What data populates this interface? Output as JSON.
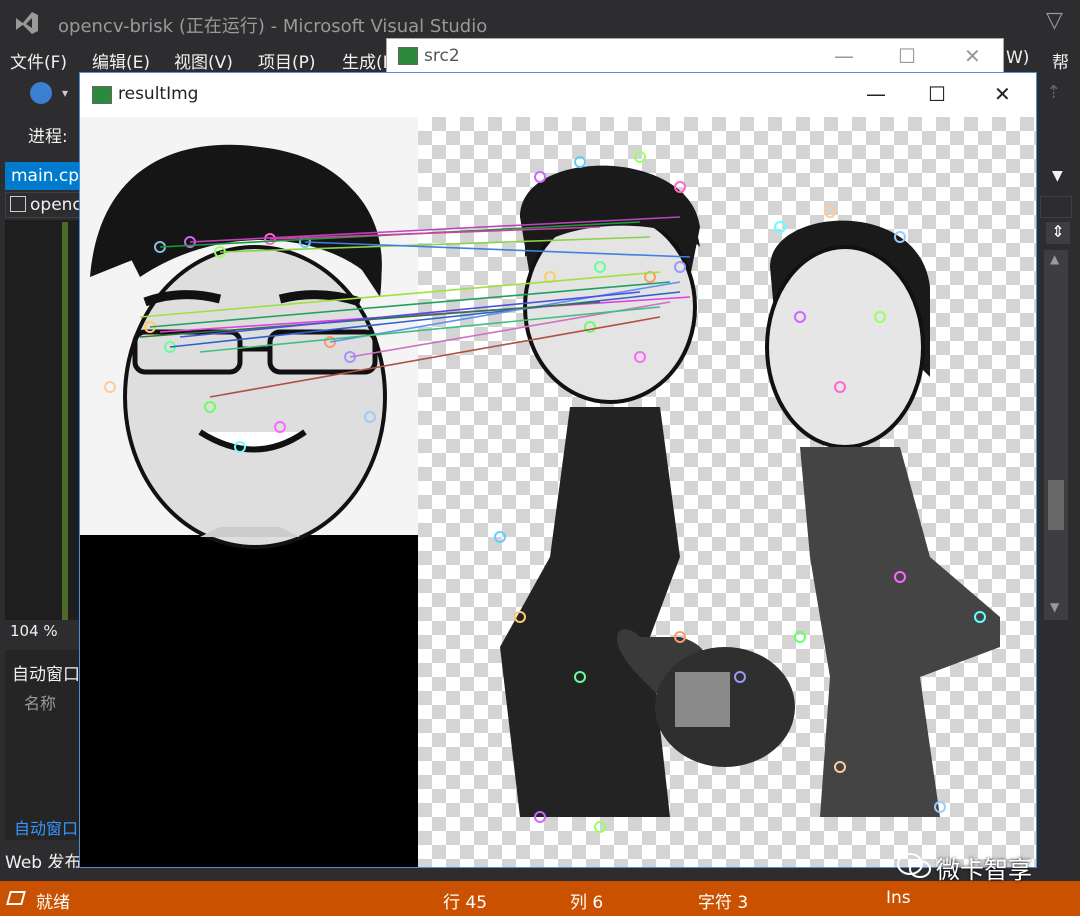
{
  "app": {
    "title": "opencv-brisk (正在运行) - Microsoft Visual Studio"
  },
  "menu": {
    "items": [
      "文件(F)",
      "编辑(E)",
      "视图(V)",
      "项目(P)",
      "生成(B"
    ],
    "right_items": [
      "W)",
      "帮助"
    ]
  },
  "toolbar": {
    "progress_label": "进程:"
  },
  "editor": {
    "active_tab": "main.cpp",
    "secondary_tab": "opencv",
    "zoom": "104 %"
  },
  "autos": {
    "title": "自动窗口",
    "column_name": "名称",
    "tab_label": "自动窗口",
    "web_publish": "Web 发布"
  },
  "windows": {
    "src2_title": "src2",
    "result_title": "resultImg"
  },
  "status": {
    "ready": "就绪",
    "line": "行 45",
    "col": "列 6",
    "char": "字符 3",
    "mode": "Ins"
  },
  "watermark": {
    "text": "微卡智享"
  },
  "colors": {
    "accent": "#007acc",
    "status_bar": "#ca5100",
    "vs_dark": "#2d2d30"
  }
}
